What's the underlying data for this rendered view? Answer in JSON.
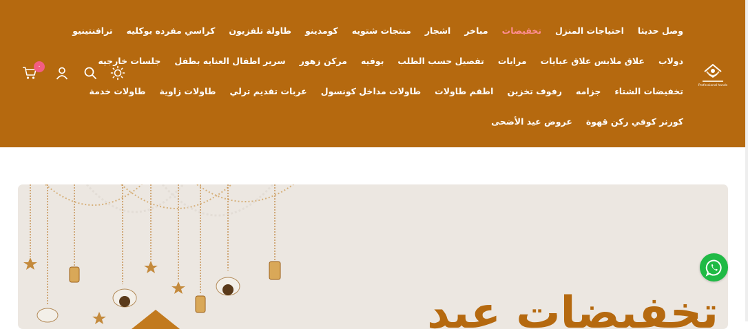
{
  "colors": {
    "header_bg": "#b5690f",
    "nav_text": "#ffffff",
    "nav_active": "#ff8d92",
    "badge": "#f35d83",
    "whatsapp": "#1fba45",
    "banner_bg": "#ece7e1"
  },
  "nav": {
    "rows": [
      [
        "وصل حديثا",
        "احتياجات المنزل",
        "تخفيضات",
        "مباخر",
        "اشجار",
        "منتجات شتويه",
        "كومدينو",
        "طاولة تلفزيون",
        "كراسي مفرده بوكليه",
        "ترافنتينيو"
      ],
      [
        "دولاب",
        "علاق ملابس علاق عبايات",
        "مرايات",
        "تفصيل حسب الطلب",
        "بوفيه",
        "مركن زهور",
        "سرير اطفال العنايه بطفل",
        "جلسات خارجيه"
      ],
      [
        "تخفيضات الشتاء",
        "جزامه",
        "رفوف تخزين",
        "اطقم طاولات",
        "طاولات مداخل كونسول",
        "عربات تقديم ترلي",
        "طاولات زاوية",
        "طاولات خدمة"
      ],
      [
        "كورنر كوفي ركن قهوة",
        "عروض عيد الأضحى"
      ]
    ],
    "active": "تخفيضات"
  },
  "logo": {
    "caption": "Professional hands"
  },
  "tools": {
    "icons": [
      "sun-icon",
      "search-icon",
      "user-icon",
      "cart-icon"
    ],
    "cart_count": "٠"
  },
  "banner": {
    "title": "تخفيضات عيد"
  }
}
